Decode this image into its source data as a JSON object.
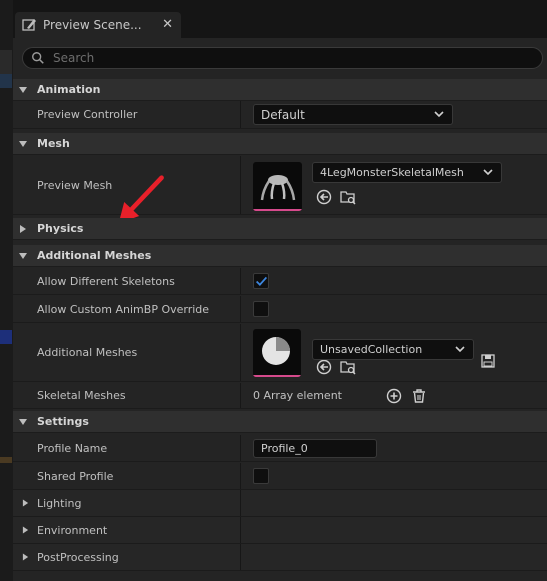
{
  "tab": {
    "title": "Preview Scene...",
    "close_glyph": "✕"
  },
  "search": {
    "placeholder": "Search"
  },
  "animation": {
    "label": "Animation",
    "preview_controller": {
      "label": "Preview Controller",
      "value": "Default"
    }
  },
  "mesh": {
    "label": "Mesh",
    "preview_mesh": {
      "label": "Preview Mesh",
      "value": "4LegMonsterSkeletalMesh"
    }
  },
  "physics": {
    "label": "Physics"
  },
  "additional_meshes": {
    "label": "Additional Meshes",
    "allow_different_skeletons": {
      "label": "Allow Different Skeletons",
      "checked": true
    },
    "allow_custom_animbp": {
      "label": "Allow Custom AnimBP Override",
      "checked": false
    },
    "additional_meshes_prop": {
      "label": "Additional Meshes",
      "value": "UnsavedCollection"
    },
    "skeletal_meshes": {
      "label": "Skeletal Meshes",
      "value": "0 Array element"
    }
  },
  "settings": {
    "label": "Settings",
    "profile_name": {
      "label": "Profile Name",
      "value": "Profile_0"
    },
    "shared_profile": {
      "label": "Shared Profile",
      "checked": false
    },
    "lighting": {
      "label": "Lighting"
    },
    "environment": {
      "label": "Environment"
    },
    "post_processing": {
      "label": "PostProcessing"
    }
  },
  "icons": {
    "tab": "preview-scene-tab-icon",
    "search": "search-icon",
    "expanded": "triangle-down-icon",
    "collapsed": "triangle-right-icon",
    "dropdown": "chevron-down-icon",
    "use_selected": "use-selected-arrow-icon",
    "browse": "browse-folder-search-icon",
    "save": "save-disk-icon",
    "add": "add-circle-icon",
    "delete": "trash-icon",
    "check": "checkmark-icon",
    "annotation": "red-arrow-icon"
  },
  "colors": {
    "accent_check": "#3d87e0",
    "thumbnail_underline": "#d64a8c",
    "annotation_arrow": "#e8202a"
  }
}
